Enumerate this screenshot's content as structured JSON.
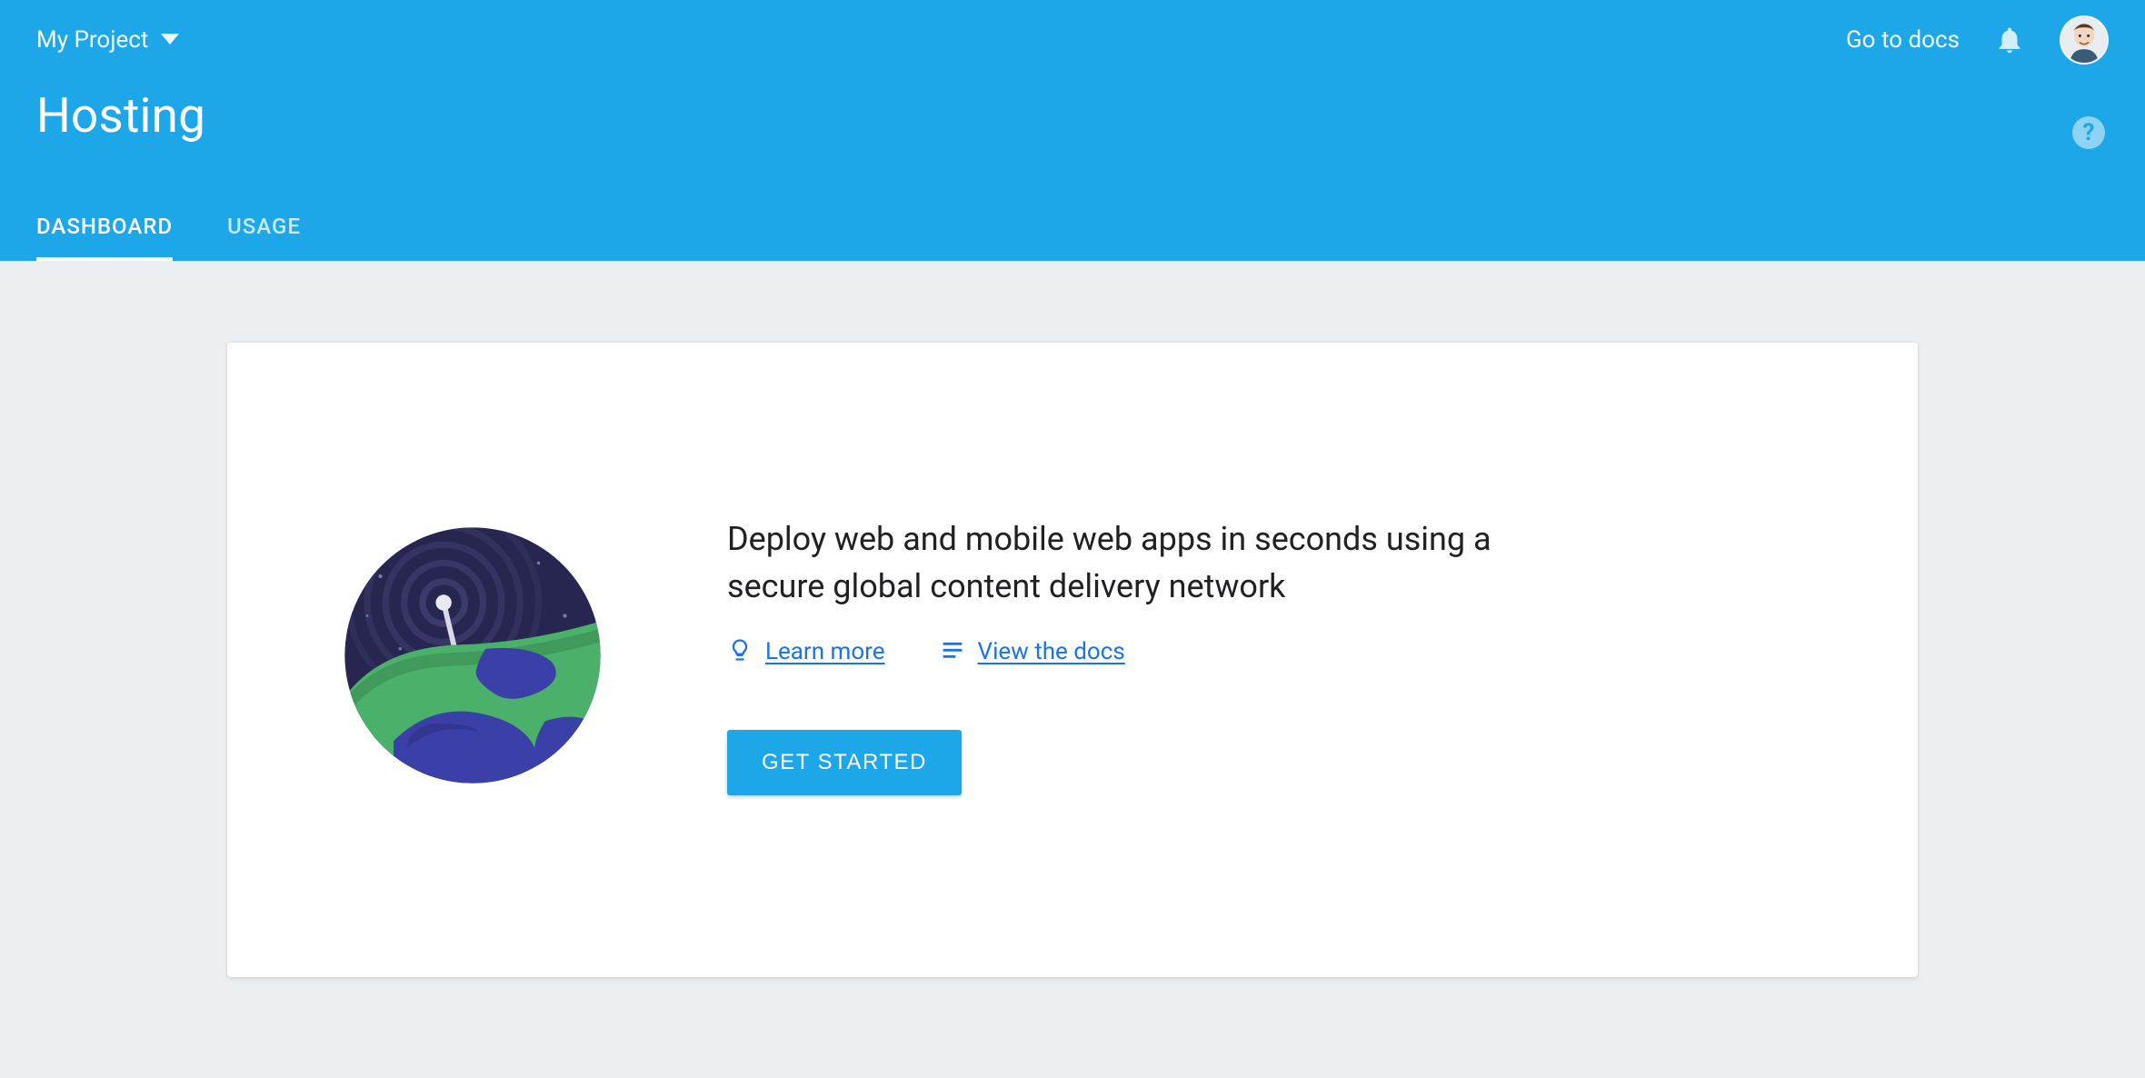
{
  "topbar": {
    "project_name": "My Project",
    "docs_link_label": "Go to docs"
  },
  "page": {
    "title": "Hosting"
  },
  "tabs": [
    {
      "label": "DASHBOARD",
      "active": true
    },
    {
      "label": "USAGE",
      "active": false
    }
  ],
  "card": {
    "headline": "Deploy web and mobile web apps in seconds using a secure global content delivery network",
    "learn_more_label": "Learn more",
    "view_docs_label": "View the docs",
    "cta_label": "GET STARTED"
  }
}
